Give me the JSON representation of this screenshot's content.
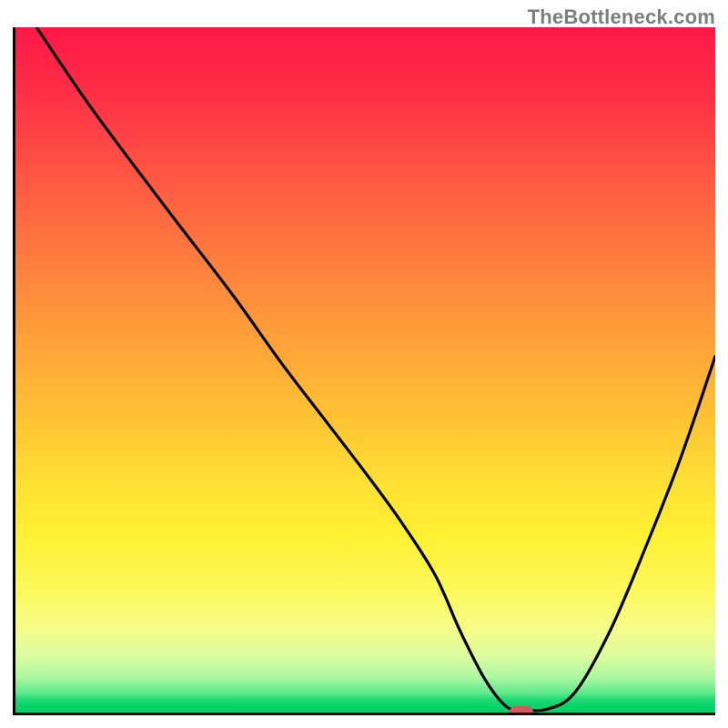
{
  "watermark": "TheBottleneck.com",
  "colors": {
    "axis": "#000000",
    "curve": "#000000",
    "marker": "#d05a60"
  },
  "chart_data": {
    "type": "line",
    "title": "",
    "xlabel": "",
    "ylabel": "",
    "xlim": [
      0,
      100
    ],
    "ylim": [
      0,
      100
    ],
    "grid": false,
    "legend": false,
    "x": [
      3,
      11,
      22,
      31,
      38,
      44,
      50,
      55,
      60,
      63.5,
      67,
      70,
      72,
      76,
      80,
      85,
      90,
      95,
      100
    ],
    "values": [
      100,
      88,
      73,
      61,
      51,
      43,
      35,
      28,
      20,
      12,
      5,
      1,
      0.5,
      0.5,
      3,
      12,
      24,
      37,
      52
    ],
    "marker": {
      "x": 72,
      "y": 0.5
    },
    "annotations": []
  }
}
